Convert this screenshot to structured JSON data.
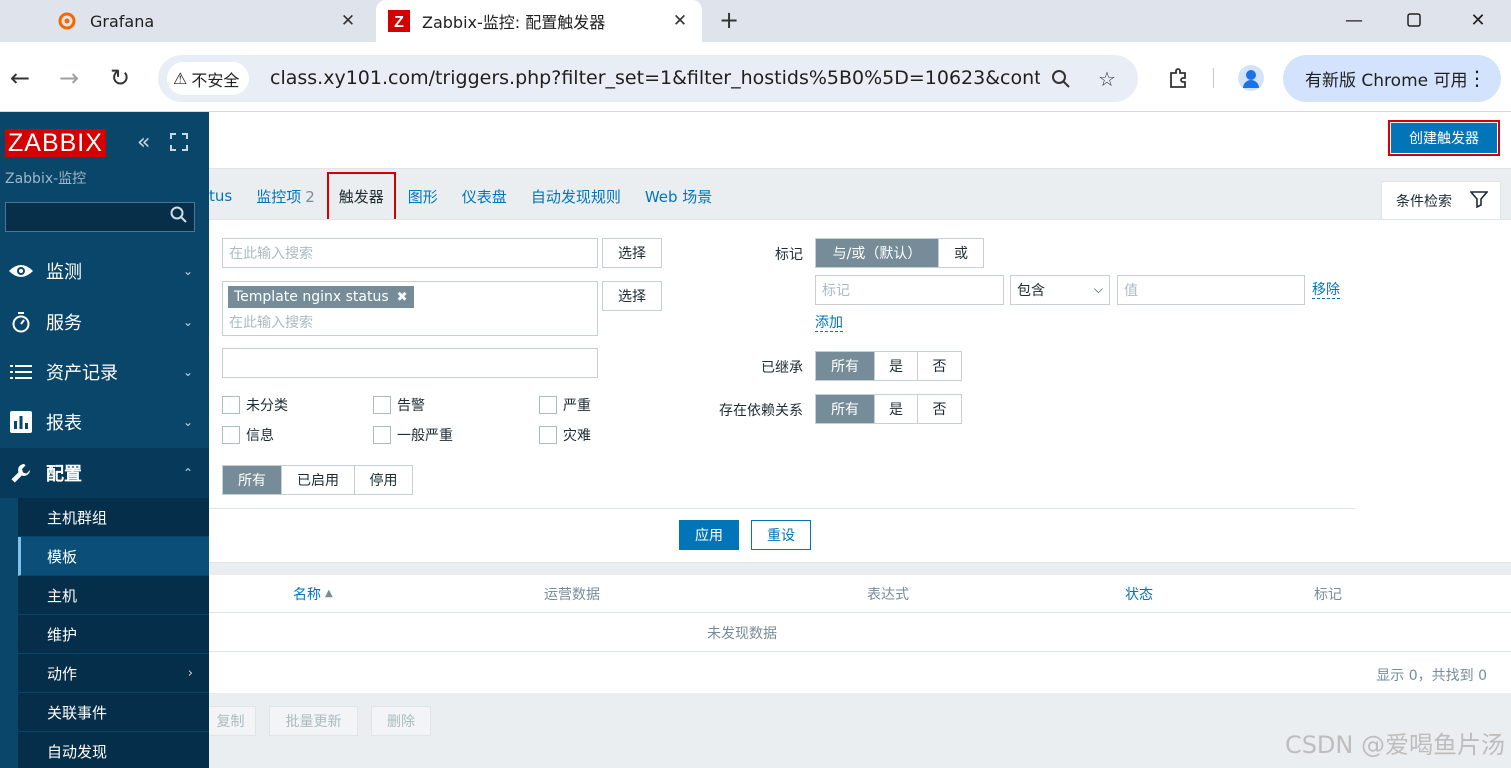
{
  "browser": {
    "tabs": [
      {
        "title": "Grafana"
      },
      {
        "title": "Zabbix-监控: 配置触发器"
      }
    ],
    "security_label": "不安全",
    "url": "class.xy101.com/triggers.php?filter_set=1&filter_hostids%5B0%5D=10623&cont...",
    "update_button": "有新版 Chrome 可用"
  },
  "sidebar": {
    "logo": "ZABBIX",
    "server_name": "Zabbix-监控",
    "menu": [
      {
        "label": "监测",
        "icon": "eye-icon"
      },
      {
        "label": "服务",
        "icon": "stopwatch-icon"
      },
      {
        "label": "资产记录",
        "icon": "list-icon"
      },
      {
        "label": "报表",
        "icon": "bar-chart-icon"
      },
      {
        "label": "配置",
        "icon": "wrench-icon"
      }
    ],
    "submenu": [
      "主机群组",
      "模板",
      "主机",
      "维护",
      "动作",
      "关联事件",
      "自动发现"
    ]
  },
  "header": {
    "create_button": "创建触发器"
  },
  "tabs": {
    "status_partial": "tus",
    "items_label": "监控项",
    "items_count": "2",
    "triggers": "触发器",
    "graphs": "图形",
    "dashboards": "仪表盘",
    "discovery": "自动发现规则",
    "web": "Web 场景",
    "filter": "条件检索"
  },
  "filter": {
    "search_placeholder": "在此输入搜索",
    "select_button": "选择",
    "host_chip": "Template nginx status",
    "severities": [
      "未分类",
      "告警",
      "严重",
      "信息",
      "一般严重",
      "灾难"
    ],
    "state_options": [
      "所有",
      "已启用",
      "停用"
    ],
    "tags_label": "标记",
    "tags_ops": [
      "与/或（默认）",
      "或"
    ],
    "tag_placeholder": "标记",
    "tag_operator": "包含",
    "value_placeholder": "值",
    "remove": "移除",
    "add": "添加",
    "inherited_label": "已继承",
    "dependencies_label": "存在依赖关系",
    "yes_no": [
      "所有",
      "是",
      "否"
    ],
    "apply": "应用",
    "reset": "重设"
  },
  "table": {
    "columns": [
      "名称",
      "运营数据",
      "表达式",
      "状态",
      "标记"
    ],
    "sort_indicator": "▲",
    "empty": "未发现数据",
    "footer": "显示 0，共找到 0"
  },
  "bulk_actions": [
    "复制",
    "批量更新",
    "删除"
  ],
  "watermark": "CSDN @爱喝鱼片汤"
}
